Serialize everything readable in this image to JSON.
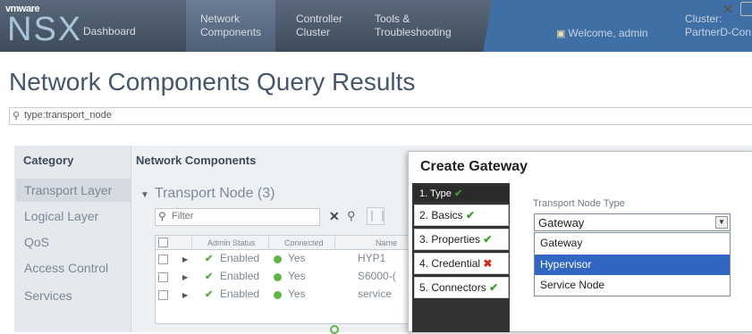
{
  "topbar": {
    "logo_top": "vmware",
    "logo_main": "NSX",
    "nav": [
      {
        "label": "Dashboard"
      },
      {
        "label": "Network\nComponents"
      },
      {
        "label": "Controller\nCluster"
      },
      {
        "label": "Tools &\nTroubleshooting"
      }
    ],
    "welcome": "Welcome, admin",
    "cluster_label": "Cluster:",
    "cluster_value": "PartnerD-Con"
  },
  "page": {
    "title": "Network Components Query Results",
    "search_value": "type:transport_node"
  },
  "category": {
    "header": "Category",
    "items": [
      "Transport Layer",
      "Logical Layer",
      "QoS",
      "Access Control",
      "Services"
    ]
  },
  "components": {
    "header": "Network Components",
    "group_label": "Transport Node (3)",
    "filter_placeholder": "Filter",
    "columns": [
      "Admin Status",
      "Connected",
      "Name"
    ],
    "rows": [
      {
        "admin": "Enabled",
        "connected": "Yes",
        "name": "HYP1"
      },
      {
        "admin": "Enabled",
        "connected": "Yes",
        "name": "S6000-("
      },
      {
        "admin": "Enabled",
        "connected": "Yes",
        "name": "service"
      }
    ]
  },
  "dialog": {
    "title": "Create Gateway",
    "steps": [
      {
        "label": "1. Type",
        "status": "ok"
      },
      {
        "label": "2. Basics",
        "status": "ok"
      },
      {
        "label": "3. Properties",
        "status": "ok"
      },
      {
        "label": "4. Credential",
        "status": "error"
      },
      {
        "label": "5. Connectors",
        "status": "ok"
      }
    ],
    "field_label": "Transport Node Type",
    "selected_value": "Gateway",
    "options": [
      "Gateway",
      "Hypervisor",
      "Service Node"
    ],
    "highlighted_option": "Hypervisor"
  }
}
